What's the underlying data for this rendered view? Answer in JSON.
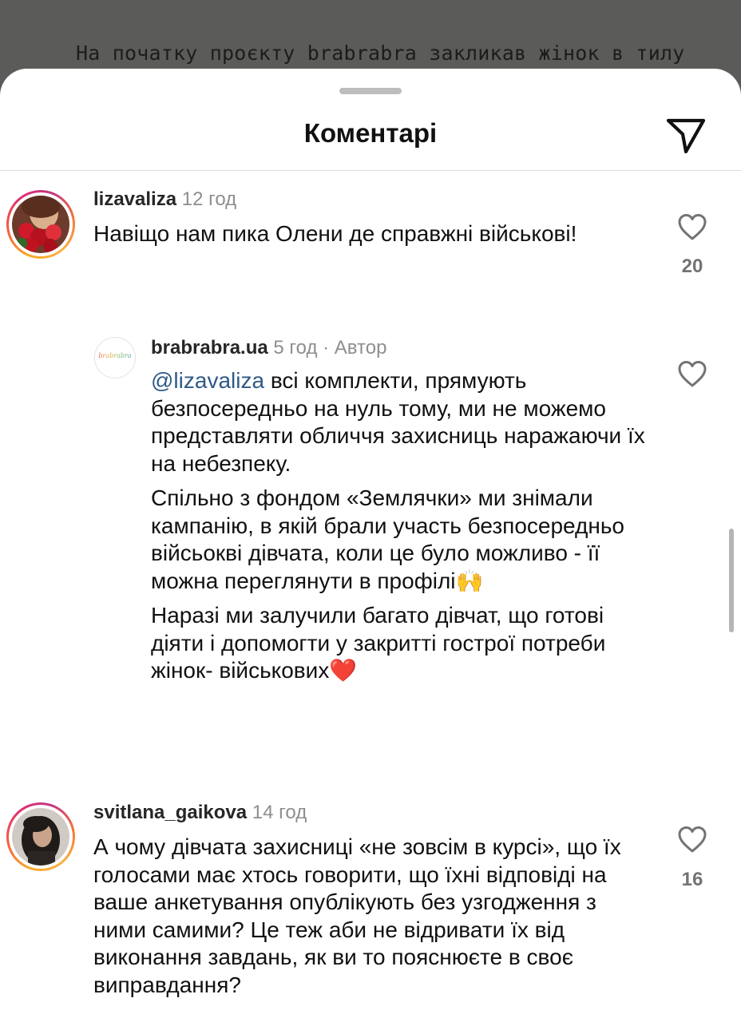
{
  "backdrop": {
    "caption": "На початку проєкту brabrabra закликав жінок в тилу"
  },
  "sheet": {
    "title": "Коментарі",
    "share_icon": "send-paper-plane-icon"
  },
  "comments": [
    {
      "username": "lizavaliza",
      "time": "12 год",
      "text": "Навіщо нам пика Олени де справжні військові!",
      "like_count": "20",
      "avatar": "photo-with-roses",
      "has_story_ring": true
    },
    {
      "username": "brabrabra.ua",
      "time": "5 год",
      "author_badge": "· Автор",
      "mention": "@lizavaliza",
      "paragraphs": [
        "всі комплекти, прямують безпосередньо на нуль тому, ми не можемо представляти обличчя захисниць наражаючи їх на небезпеку.",
        "Спільно з фондом «Землячки» ми знімали кампанію, в якій брали участь безпосередньо війсьоквi дівчата, коли це було можливо - її можна переглянути в профілі🙌",
        "Наразі ми залучили багато дівчат, що готові діяти і допомогти у закритті гострої потреби жінок- військових❤️"
      ],
      "avatar_logo_text": "brabrabra",
      "like_count": ""
    },
    {
      "username": "svitlana_gaikova",
      "time": "14 год",
      "text": "А чому дівчата захисниці «не зовсім в курсі», що їх голосами має хтось говорити, що їхні відповіді на ваше анкетування опублікують без узгодження з ними самими? Це теж аби не відривати їх від виконання завдань, як ви то пояснюєте в своє виправдання?",
      "like_count": "16",
      "avatar": "photo-woman-dark-hair",
      "has_story_ring": true
    }
  ],
  "colors": {
    "mention": "#2f5a87",
    "muted": "#8e8e8e",
    "story_ring": "#e1306c"
  }
}
